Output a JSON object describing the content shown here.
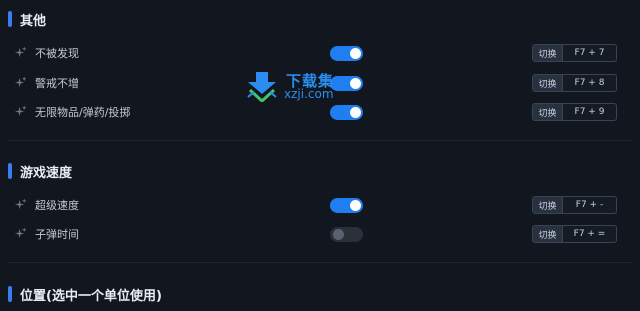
{
  "sections": [
    {
      "title": "其他",
      "rows": [
        {
          "label": "不被发现",
          "enabled": true,
          "action": "切换",
          "keys": "F7 + 7"
        },
        {
          "label": "警戒不增",
          "enabled": true,
          "action": "切换",
          "keys": "F7 + 8"
        },
        {
          "label": "无限物品/弹药/投掷",
          "enabled": true,
          "action": "切换",
          "keys": "F7 + 9"
        }
      ]
    },
    {
      "title": "游戏速度",
      "rows": [
        {
          "label": "超级速度",
          "enabled": true,
          "action": "切换",
          "keys": "F7 + -"
        },
        {
          "label": "子弹时间",
          "enabled": false,
          "action": "切换",
          "keys": "F7 + ="
        }
      ]
    },
    {
      "title": "位置(选中一个单位使用)",
      "rows": []
    }
  ],
  "watermark": {
    "line1": "下载集",
    "line2": "xzji.com"
  },
  "colors": {
    "background": "#12171f",
    "accent": "#3b7cf0",
    "toggle_on": "#1f7ef0",
    "watermark": "#2b8df0"
  },
  "icons": {
    "row_icon": "sparkle-icon",
    "watermark_icon": "download-arrow-icon"
  }
}
